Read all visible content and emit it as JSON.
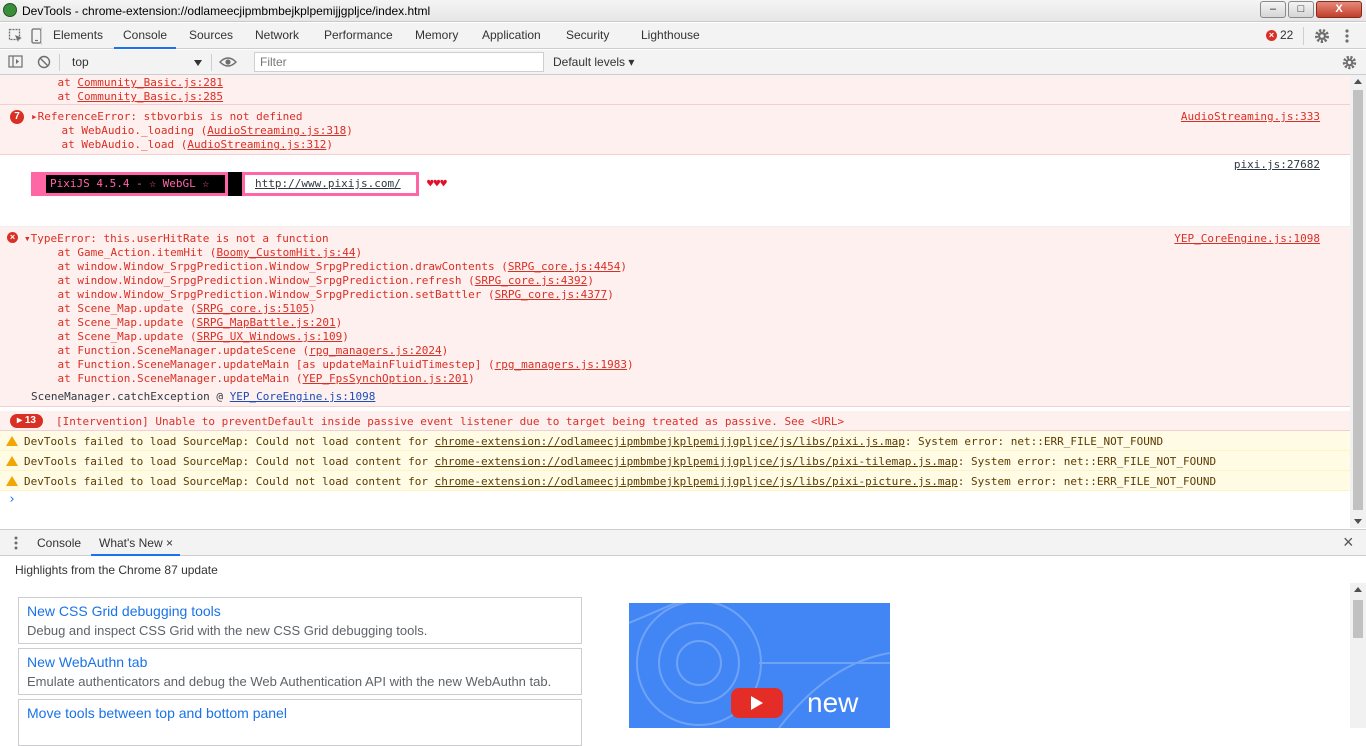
{
  "window": {
    "title": "DevTools - chrome-extension://odlameecjipmbmbejkplpemijjgpljce/index.html",
    "minimize_glyph": "–",
    "maximize_glyph": "□",
    "close_glyph": "X"
  },
  "tabs": [
    {
      "label": "Elements"
    },
    {
      "label": "Console",
      "active": true
    },
    {
      "label": "Sources"
    },
    {
      "label": "Network"
    },
    {
      "label": "Performance"
    },
    {
      "label": "Memory"
    },
    {
      "label": "Application"
    },
    {
      "label": "Security"
    },
    {
      "label": "Lighthouse"
    }
  ],
  "error_count": "22",
  "toolbar": {
    "context": "top",
    "filter_placeholder": "Filter",
    "levels": "Default levels ▾"
  },
  "console": {
    "stack_tail": {
      "l1_pre": "    at ",
      "l1_link": "Community_Basic.js:281",
      "l2_pre": "    at ",
      "l2_link": "Community_Basic.js:285"
    },
    "ref_error": {
      "count": "7",
      "text": "▸ReferenceError: stbvorbis is not defined",
      "source": "AudioStreaming.js:333",
      "l1_pre": "    at WebAudio._loading (",
      "l1_link": "AudioStreaming.js:318",
      "l1_post": ")",
      "l2_pre": "    at WebAudio._load (",
      "l2_link": "AudioStreaming.js:312",
      "l2_post": ")"
    },
    "pixi": {
      "source": "pixi.js:27682",
      "banner": "PixiJS 4.5.4 - ☆ WebGL ☆",
      "url": "http://www.pixijs.com/",
      "hearts": "♥♥♥"
    },
    "type_error": {
      "text": "▾TypeError: this.userHitRate is not a function",
      "source": "YEP_CoreEngine.js:1098",
      "frames": [
        {
          "pre": "    at Game_Action.itemHit (",
          "link": "Boomy_CustomHit.js:44",
          "post": ")"
        },
        {
          "pre": "    at window.Window_SrpgPrediction.Window_SrpgPrediction.drawContents (",
          "link": "SRPG_core.js:4454",
          "post": ")"
        },
        {
          "pre": "    at window.Window_SrpgPrediction.Window_SrpgPrediction.refresh (",
          "link": "SRPG_core.js:4392",
          "post": ")"
        },
        {
          "pre": "    at window.Window_SrpgPrediction.Window_SrpgPrediction.setBattler (",
          "link": "SRPG_core.js:4377",
          "post": ")"
        },
        {
          "pre": "    at Scene_Map.update (",
          "link": "SRPG_core.js:5105",
          "post": ")"
        },
        {
          "pre": "    at Scene_Map.update (",
          "link": "SRPG_MapBattle.js:201",
          "post": ")"
        },
        {
          "pre": "    at Scene_Map.update (",
          "link": "SRPG_UX_Windows.js:109",
          "post": ")"
        },
        {
          "pre": "    at Function.SceneManager.updateScene (",
          "link": "rpg_managers.js:2024",
          "post": ")"
        },
        {
          "pre": "    at Function.SceneManager.updateMain [as updateMainFluidTimestep] (",
          "link": "rpg_managers.js:1983",
          "post": ")"
        },
        {
          "pre": "    at Function.SceneManager.updateMain (",
          "link": "YEP_FpsSynchOption.js:201",
          "post": ")"
        }
      ],
      "catch_pre": "SceneManager.catchException @ ",
      "catch_link": "YEP_CoreEngine.js:1098"
    },
    "intervention": {
      "count": "13",
      "text": "[Intervention] Unable to preventDefault inside passive event listener due to target being treated as passive. See <URL>"
    },
    "warnings": [
      {
        "pre": "DevTools failed to load SourceMap: Could not load content for ",
        "link": "chrome-extension://odlameecjipmbmbejkplpemijjgpljce/js/libs/pixi.js.map",
        "post": ": System error: net::ERR_FILE_NOT_FOUND"
      },
      {
        "pre": "DevTools failed to load SourceMap: Could not load content for ",
        "link": "chrome-extension://odlameecjipmbmbejkplpemijjgpljce/js/libs/pixi-tilemap.js.map",
        "post": ": System error: net::ERR_FILE_NOT_FOUND"
      },
      {
        "pre": "DevTools failed to load SourceMap: Could not load content for ",
        "link": "chrome-extension://odlameecjipmbmbejkplpemijjgpljce/js/libs/pixi-picture.js.map",
        "post": ": System error: net::ERR_FILE_NOT_FOUND"
      }
    ],
    "prompt": "›"
  },
  "drawer": {
    "tabs": [
      {
        "label": "Console"
      },
      {
        "label": "What's New",
        "active": true
      }
    ],
    "close_glyph": "×",
    "highlights": "Highlights from the Chrome 87 update",
    "cards": [
      {
        "title": "New CSS Grid debugging tools",
        "desc": "Debug and inspect CSS Grid with the new CSS Grid debugging tools."
      },
      {
        "title": "New WebAuthn tab",
        "desc": "Emulate authenticators and debug the Web Authentication API with the new WebAuthn tab."
      },
      {
        "title": "Move tools between top and bottom panel",
        "desc": ""
      }
    ],
    "video_word": "new"
  },
  "colors": {
    "error_bg": "#fff0f0",
    "error_text": "#d93025",
    "warning_bg": "#fffbe5",
    "accent": "#1a73e8",
    "pixi_pink": "#ff66a5"
  }
}
